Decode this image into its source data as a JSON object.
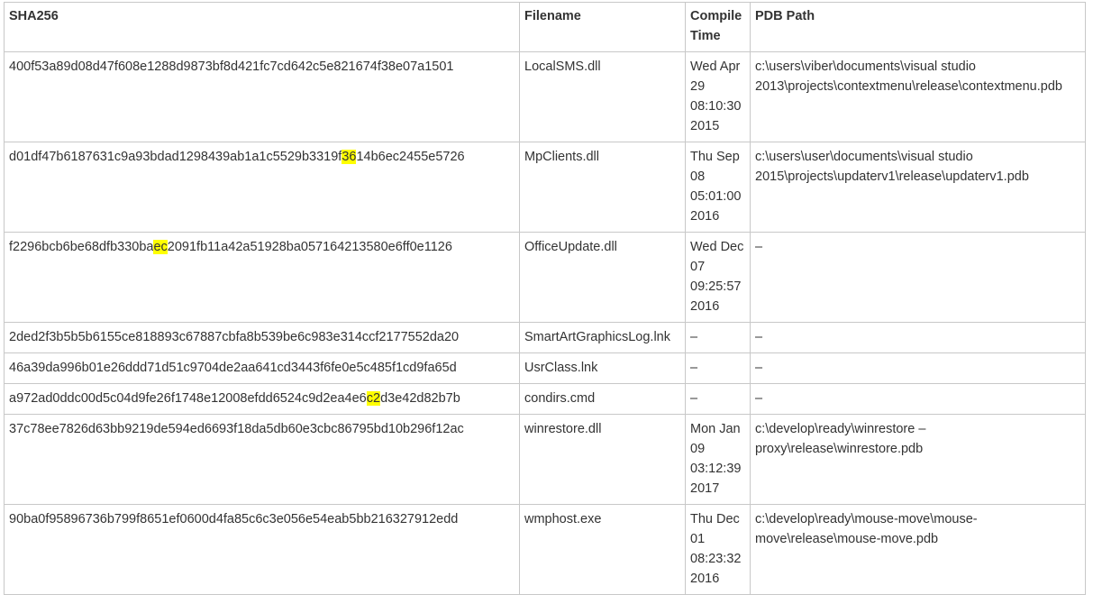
{
  "headers": [
    "SHA256",
    "Filename",
    "Compile Time",
    "PDB Path"
  ],
  "highlight": "c2",
  "highlight_color": "#ffff00",
  "rows": [
    {
      "sha256": "400f53a89d08d47f608e1288d9873bf8d421fc7cd642c5e821674f38e07a1501",
      "hl": null,
      "filename": "LocalSMS.dll",
      "compile_time": "Wed Apr 29 08:10:30 2015",
      "pdb": "c:\\users\\viber\\documents\\visual studio 2013\\projects\\contextmenu\\release\\contextmenu.pdb"
    },
    {
      "sha256": "d01df47b6187631c9a93bdad1298439ab1a1c5529b3319f3614b6ec2455e5726",
      "hl": 47,
      "filename": "MpClients.dll",
      "compile_time": "Thu Sep 08 05:01:00 2016",
      "pdb": "c:\\users\\user\\documents\\visual studio 2015\\projects\\updaterv1\\release\\updaterv1.pdb"
    },
    {
      "sha256": "f2296bcb6be68dfb330baec2091fb11a42a51928ba057164213580e6ff0e1126",
      "hl": 21,
      "filename": "OfficeUpdate.dll",
      "compile_time": "Wed Dec 07 09:25:57 2016",
      "pdb": "–"
    },
    {
      "sha256": "2ded2f3b5b5b6155ce818893c67887cbfa8b539be6c983e314ccf2177552da20",
      "hl": null,
      "filename": "SmartArtGraphicsLog.lnk",
      "compile_time": "–",
      "pdb": "–"
    },
    {
      "sha256": "46a39da996b01e26ddd71d51c9704de2aa641cd3443f6fe0e5c485f1cd9fa65d",
      "hl": null,
      "filename": "UsrClass.lnk",
      "compile_time": "–",
      "pdb": "–"
    },
    {
      "sha256": "a972ad0ddc00d5c04d9fe26f1748e12008efdd6524c9d2ea4e6c2d3e42d82b7b",
      "hl": 51,
      "filename": "condirs.cmd",
      "compile_time": "–",
      "pdb": "–"
    },
    {
      "sha256": "37c78ee7826d63bb9219de594ed6693f18da5db60e3cbc86795bd10b296f12ac",
      "hl": null,
      "filename": "winrestore.dll",
      "compile_time": "Mon Jan 09 03:12:39 2017",
      "pdb": "c:\\develop\\ready\\winrestore – proxy\\release\\winrestore.pdb"
    },
    {
      "sha256": "90ba0f95896736b799f8651ef0600d4fa85c6c3e056e54eab5bb216327912edd",
      "hl": null,
      "filename": "wmphost.exe",
      "compile_time": "Thu Dec 01 08:23:32 2016",
      "pdb": "c:\\develop\\ready\\mouse-move\\mouse-move\\release\\mouse-move.pdb"
    }
  ]
}
